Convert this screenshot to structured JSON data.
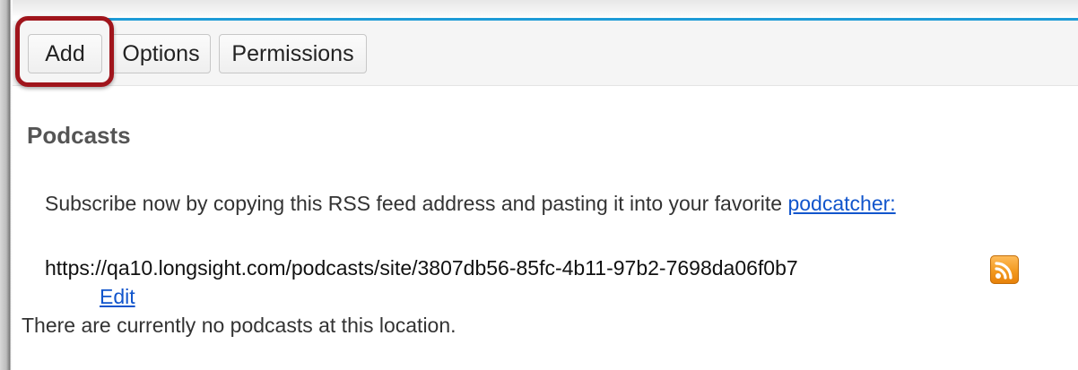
{
  "toolbar": {
    "add_label": "Add",
    "options_label": "Options",
    "permissions_label": "Permissions"
  },
  "content": {
    "title": "Podcasts",
    "subscribe_text": "Subscribe now by copying this RSS feed address and pasting it into your favorite ",
    "subscribe_link": "podcatcher:",
    "feed_url": "https://qa10.longsight.com/podcasts/site/3807db56-85fc-4b11-97b2-7698da06f0b7",
    "edit_label": "Edit",
    "empty_message": "There are currently no podcasts at this location."
  },
  "icons": {
    "rss": "rss-icon"
  },
  "colors": {
    "accent": "#1e9bd7",
    "highlight": "#a0151c",
    "link": "#1155cc",
    "rss": "#f39a20"
  }
}
